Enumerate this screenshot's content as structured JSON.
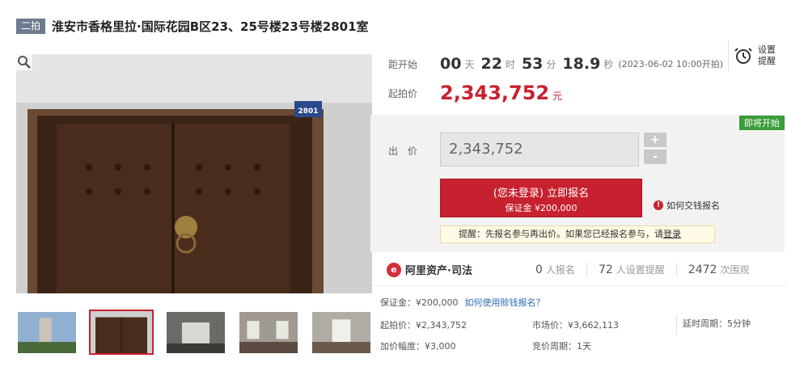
{
  "header": {
    "badge": "二拍",
    "title": "淮安市香格里拉·国际花园B区23、25号楼23号楼2801室"
  },
  "countdown": {
    "label": "距开始",
    "days": "00",
    "days_unit": "天",
    "hours": "22",
    "hours_unit": "时",
    "minutes": "53",
    "minutes_unit": "分",
    "seconds": "18.9",
    "seconds_unit": "秒",
    "start_text": "(2023-06-02 10:00开拍)"
  },
  "remind": {
    "line1": "设置",
    "line2": "提醒"
  },
  "start_price": {
    "label": "起拍价",
    "value": "2,343,752",
    "unit": "元"
  },
  "bid": {
    "status_badge": "即将开始",
    "label": "出 价",
    "input_value": "2,343,752",
    "plus": "+",
    "minus": "-",
    "signup_line1": "(您未登录) 立即报名",
    "signup_line2": "保证金 ¥200,000",
    "howto": "如何交钱报名",
    "tip_text": "提醒：先报名参与再出价。如果您已经报名参与，请",
    "tip_link": "登录"
  },
  "stats": {
    "brand": "阿里资产·司法",
    "signups_num": "0",
    "signups_label": "人报名",
    "reminders_num": "72",
    "reminders_label": "人设置提醒",
    "views_num": "2472",
    "views_label": "次围观"
  },
  "details": {
    "deposit_label": "保证金：¥200,000",
    "deposit_link": "如何使用赊钱报名？",
    "start_price_label": "起拍价：¥2,343,752",
    "market_price_label": "市场价：¥3,662,113",
    "delay_label": "延时周期：5分钟",
    "increment_label": "加价幅度：¥3,000",
    "bid_cycle_label": "竞价周期：1天"
  },
  "colors": {
    "accent": "#c7212f",
    "status_green": "#3a9c3a",
    "badge_gray": "#6d7b8f",
    "link_blue": "#2f6bb3"
  },
  "door_plate": "2801"
}
